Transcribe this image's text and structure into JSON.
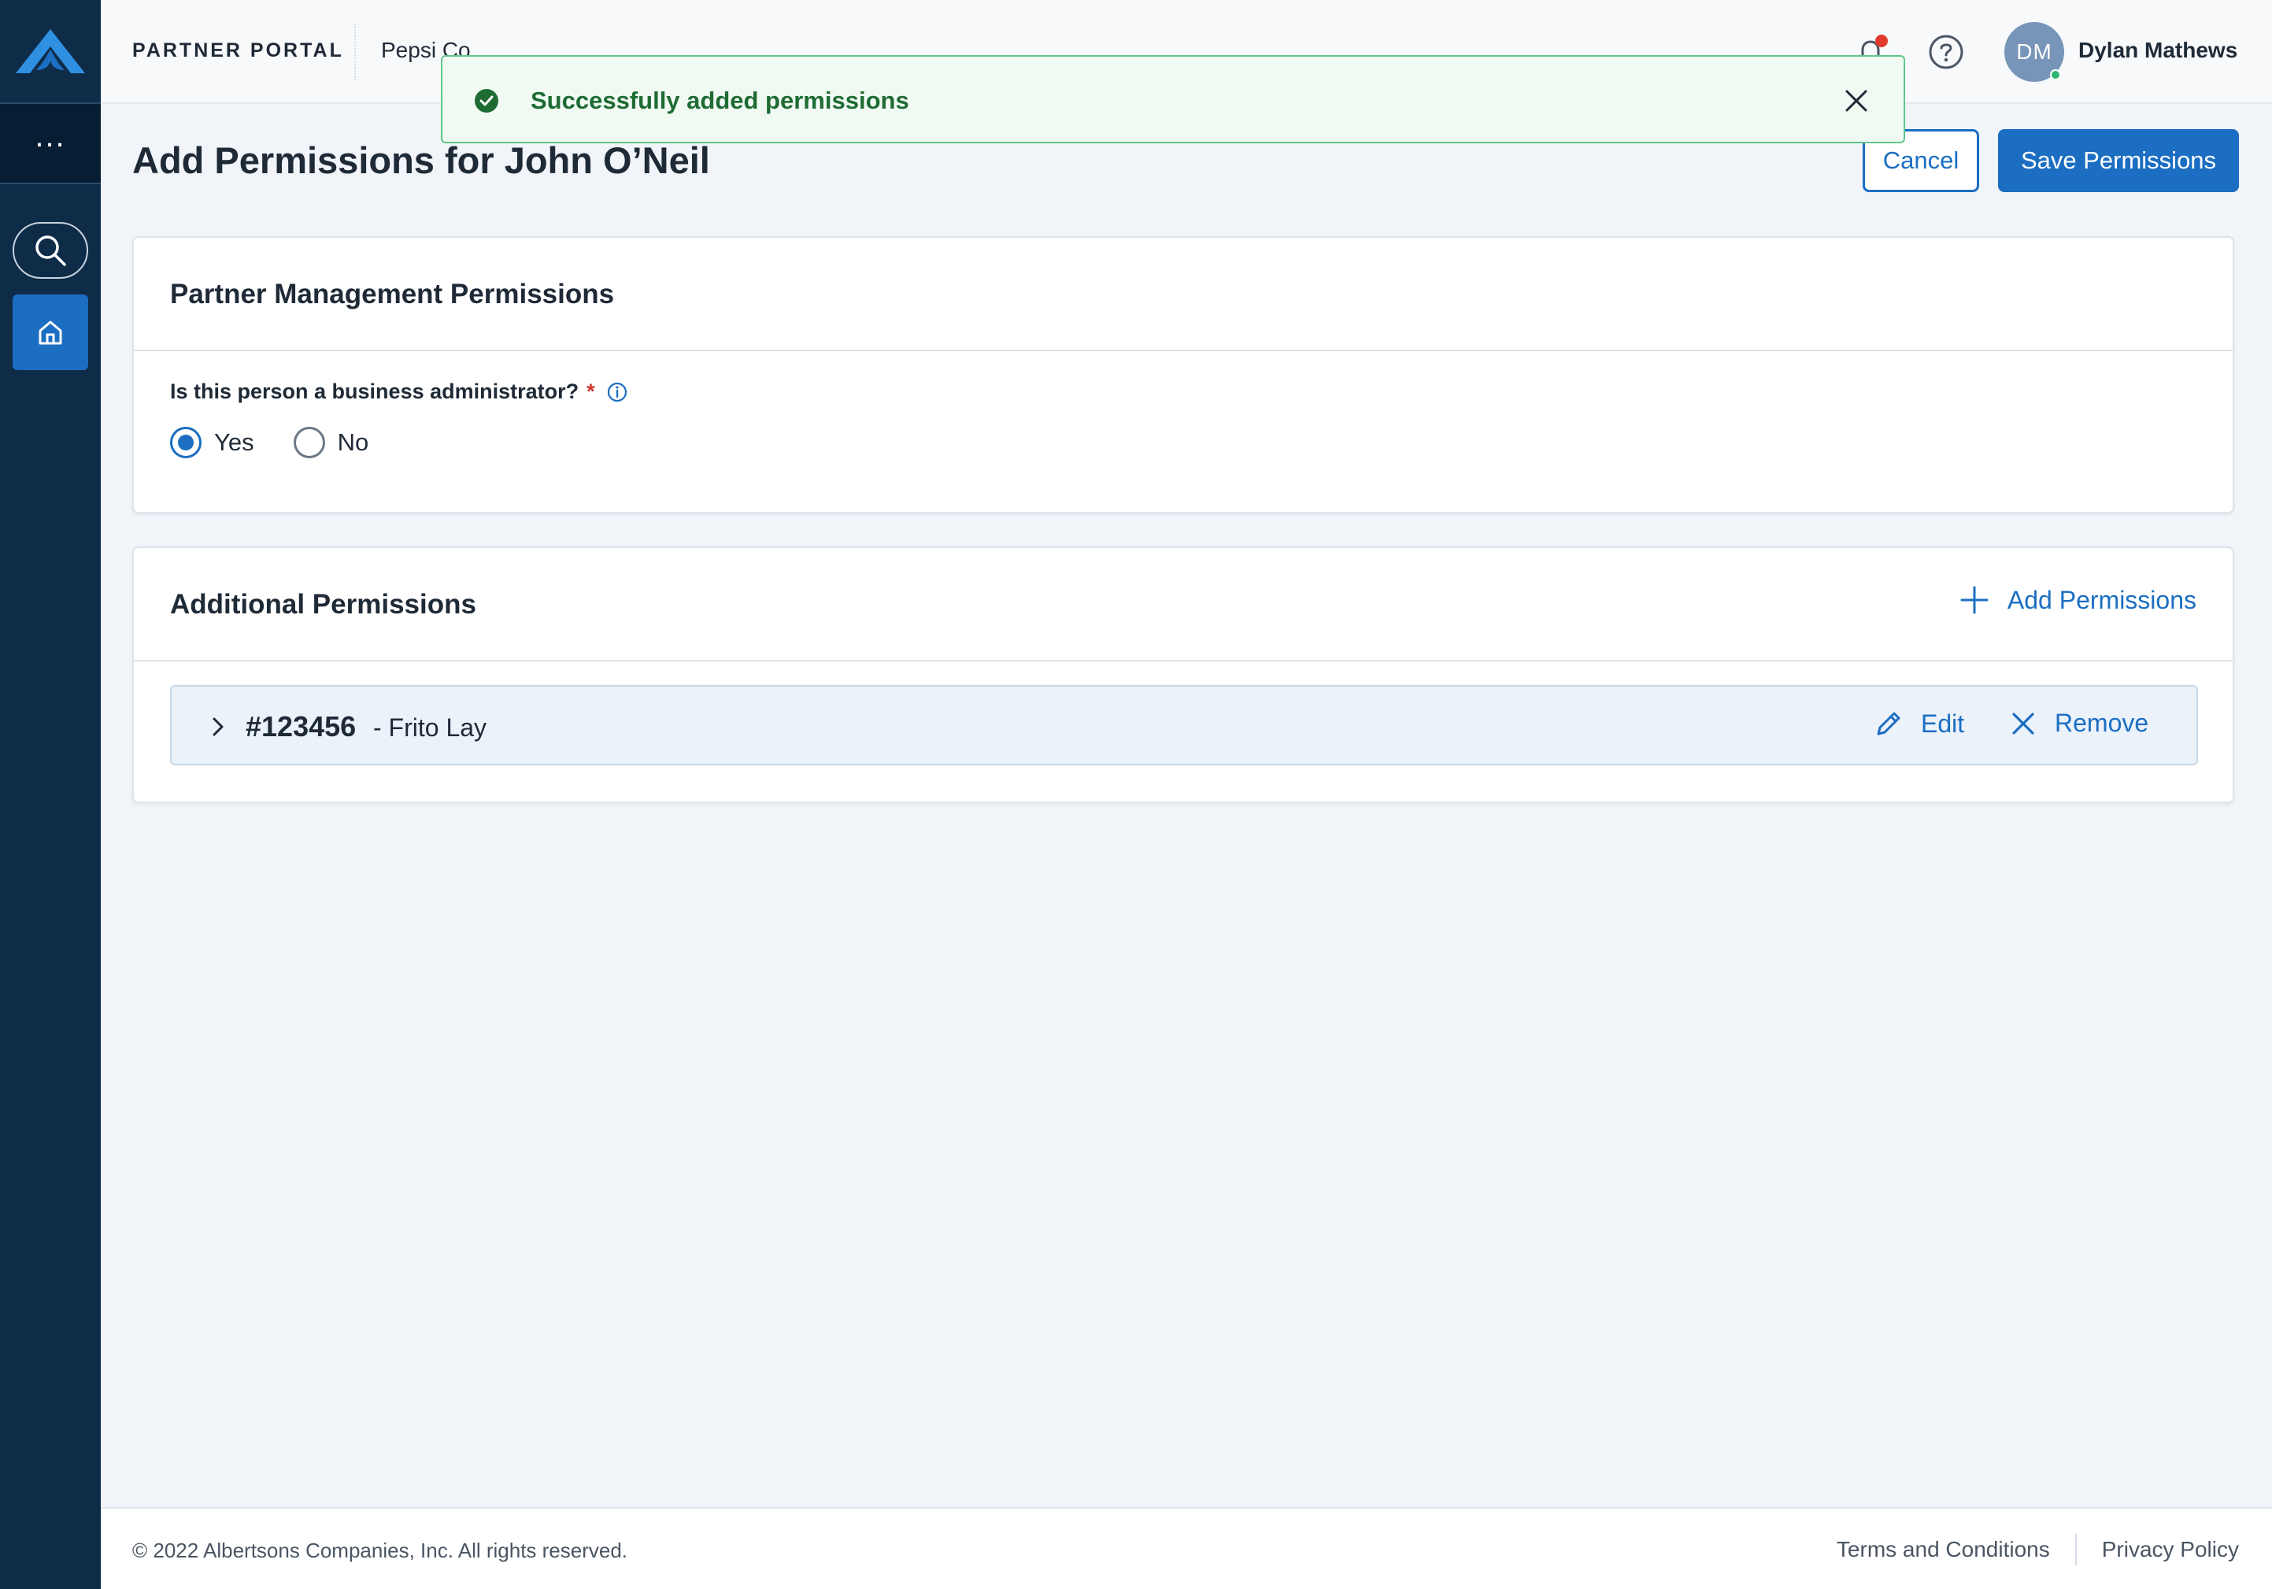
{
  "header": {
    "brand": "PARTNER PORTAL",
    "company": "Pepsi Co",
    "user_initials": "DM",
    "user_name": "Dylan Mathews"
  },
  "sidebar": {
    "more_label": "..."
  },
  "toast": {
    "message": "Successfully added permissions"
  },
  "page": {
    "title": "Add Permissions for John O’Neil",
    "cancel_label": "Cancel",
    "save_label": "Save Permissions"
  },
  "partner_management": {
    "title": "Partner Management Permissions",
    "question": "Is this person a business administrator?",
    "required_mark": "*",
    "options": [
      {
        "label": "Yes",
        "selected": true
      },
      {
        "label": "No",
        "selected": false
      }
    ]
  },
  "additional_permissions": {
    "title": "Additional Permissions",
    "add_label": "Add Permissions",
    "rows": [
      {
        "id": "#123456",
        "name": "- Frito Lay",
        "edit_label": "Edit",
        "remove_label": "Remove"
      }
    ]
  },
  "footer": {
    "copyright": "© 2022 Albertsons Companies, Inc. All rights reserved.",
    "terms": "Terms and Conditions",
    "privacy": "Privacy Policy"
  },
  "colors": {
    "primary": "#1b6ec2",
    "sidebar": "#0e2b48",
    "success": "#1e6b33",
    "required": "#d0342c"
  }
}
